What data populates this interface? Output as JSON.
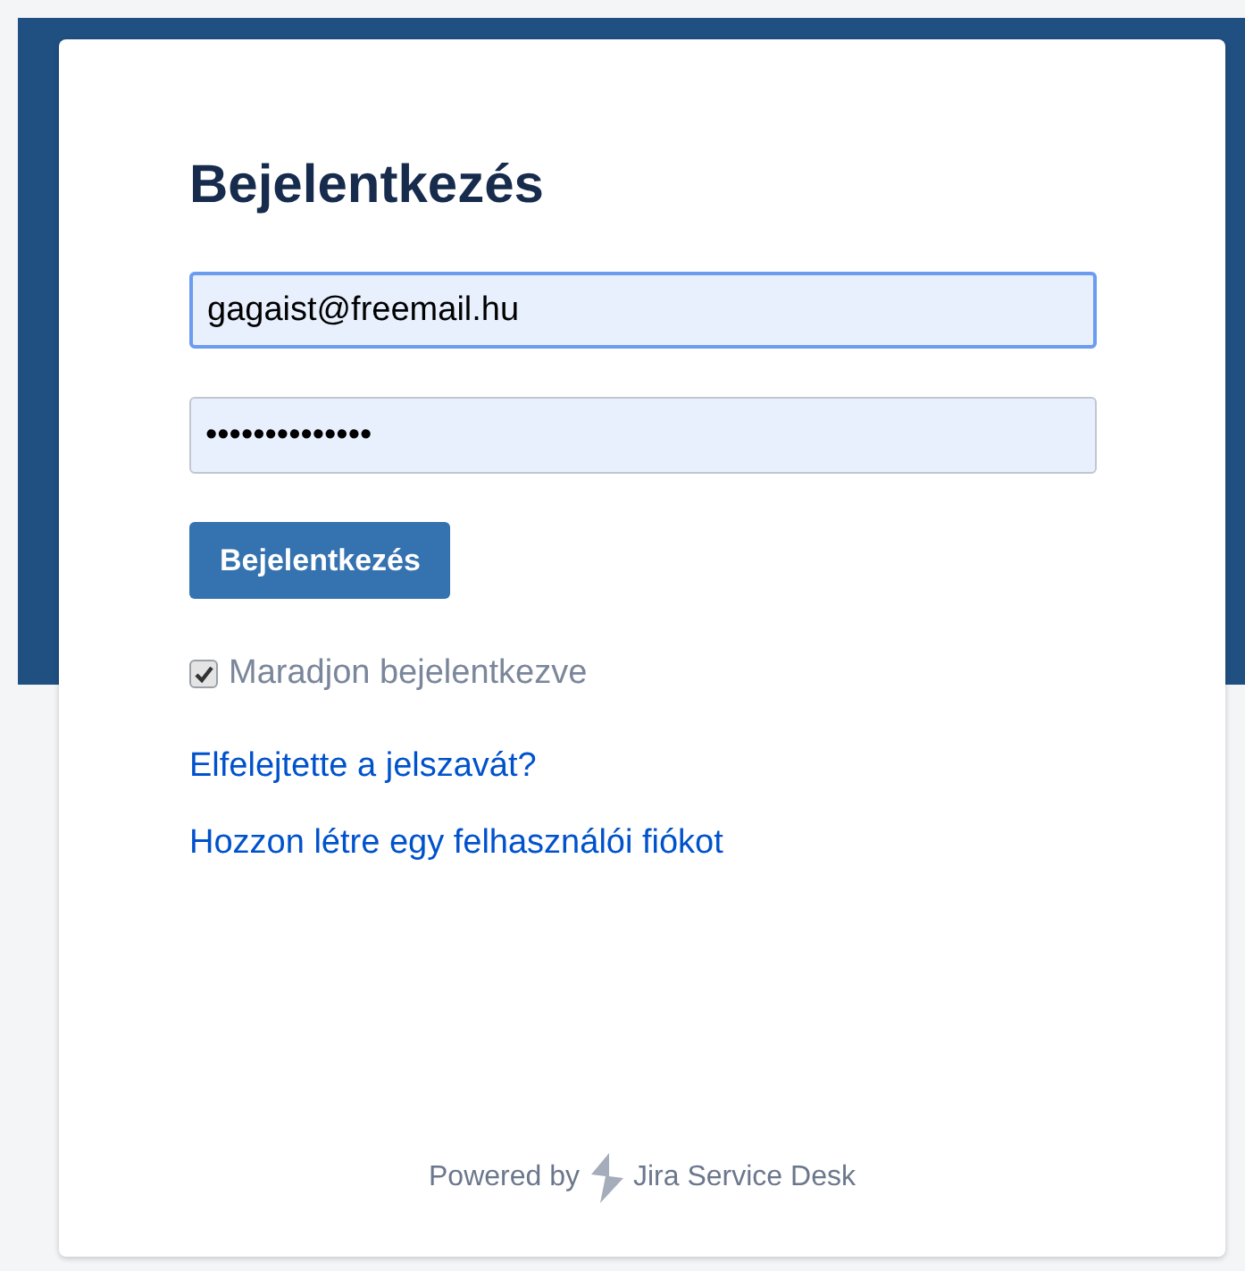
{
  "login_form": {
    "title": "Bejelentkezés",
    "email": {
      "value": "gagaist@freemail.hu",
      "focused": true
    },
    "password": {
      "value": "••••••••••••••",
      "focused": false
    },
    "submit_button": "Bejelentkezés",
    "remember": {
      "label": "Maradjon bejelentkezve",
      "checked": true
    },
    "links": [
      "Elfelejtette a jelszavát?",
      "Hozzon létre egy felhasználói fiókot"
    ]
  },
  "footer": {
    "powered_by": "Powered by",
    "product": "Jira Service Desk"
  }
}
